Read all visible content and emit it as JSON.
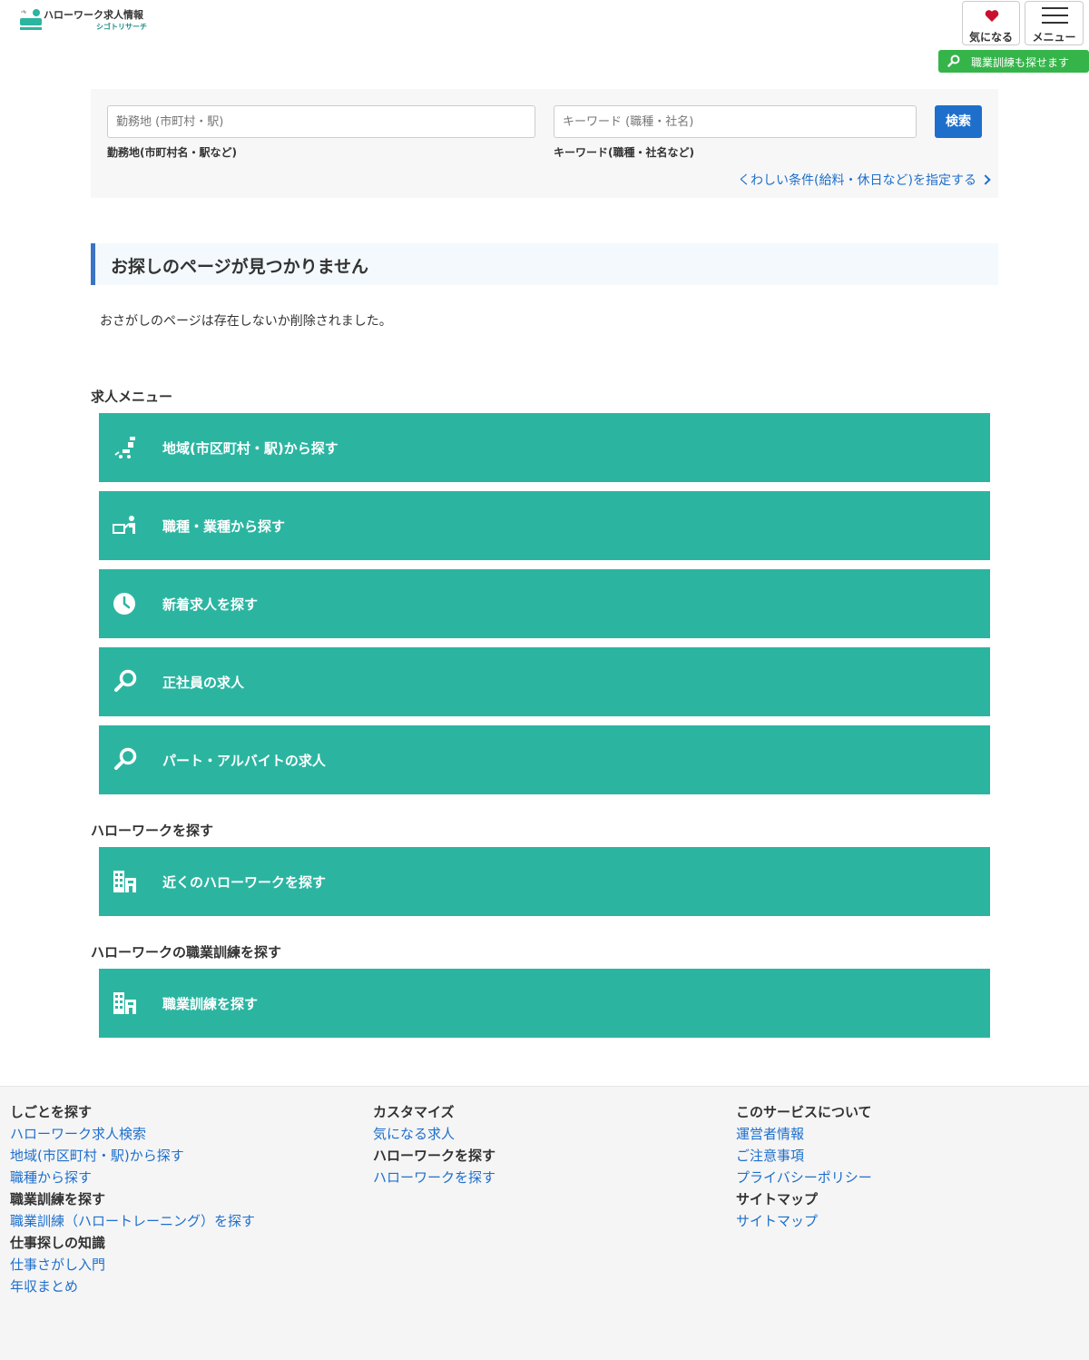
{
  "header": {
    "logo": {
      "title": "ハローワーク求人情報",
      "sub": "シゴトリサーチ"
    },
    "fav_label": "気になる",
    "menu_label": "メニュー",
    "training_label": "職業訓練も探せます"
  },
  "search": {
    "area_placeholder": "勤務地 (市町村・駅)",
    "area_hint": "勤務地(市町村名・駅など)",
    "keyword_placeholder": "キーワード (職種・社名)",
    "keyword_hint": "キーワード(職種・社名など)",
    "button_label": "検索",
    "detail_link": "くわしい条件(給料・休日など)を指定する"
  },
  "not_found": {
    "heading": "お探しのページが見つかりません",
    "message": "おさがしのページは存在しないか削除されました。"
  },
  "job_menu": {
    "title": "求人メニュー",
    "items": [
      {
        "label": "地域(市区町村・駅)から探す",
        "icon": "map-pin-icon"
      },
      {
        "label": "職種・業種から探す",
        "icon": "worker-icon"
      },
      {
        "label": "新着求人を探す",
        "icon": "clock-icon"
      },
      {
        "label": "正社員の求人",
        "icon": "search-icon"
      },
      {
        "label": "パート・アルバイトの求人",
        "icon": "search-icon"
      }
    ]
  },
  "hellowork_section": {
    "title": "ハローワークを探す",
    "items": [
      {
        "label": "近くのハローワークを探す",
        "icon": "building-icon"
      }
    ]
  },
  "training_section": {
    "title": "ハローワークの職業訓練を探す",
    "items": [
      {
        "label": "職業訓練を探す",
        "icon": "building-icon"
      }
    ]
  },
  "footer": {
    "col1": [
      {
        "type": "head",
        "text": "しごとを探す"
      },
      {
        "type": "link",
        "text": "ハローワーク求人検索"
      },
      {
        "type": "link",
        "text": "地域(市区町村・駅)から探す"
      },
      {
        "type": "link",
        "text": "職種から探す"
      },
      {
        "type": "head",
        "text": "職業訓練を探す"
      },
      {
        "type": "link",
        "text": "職業訓練（ハロートレーニング）を探す"
      },
      {
        "type": "head",
        "text": "仕事探しの知識"
      },
      {
        "type": "link",
        "text": "仕事さがし入門"
      },
      {
        "type": "link",
        "text": "年収まとめ"
      }
    ],
    "col2": [
      {
        "type": "head",
        "text": "カスタマイズ"
      },
      {
        "type": "link",
        "text": "気になる求人"
      },
      {
        "type": "head",
        "text": "ハローワークを探す"
      },
      {
        "type": "link",
        "text": "ハローワークを探す"
      }
    ],
    "col3": [
      {
        "type": "head",
        "text": "このサービスについて"
      },
      {
        "type": "link",
        "text": "運営者情報"
      },
      {
        "type": "link",
        "text": "ご注意事項"
      },
      {
        "type": "link",
        "text": "プライバシーポリシー"
      },
      {
        "type": "head",
        "text": "サイトマップ"
      },
      {
        "type": "link",
        "text": "サイトマップ"
      }
    ]
  },
  "colors": {
    "teal": "#2bb5a1",
    "blue": "#1e6fcc",
    "green": "#35b44a",
    "heart": "#c8102e"
  }
}
